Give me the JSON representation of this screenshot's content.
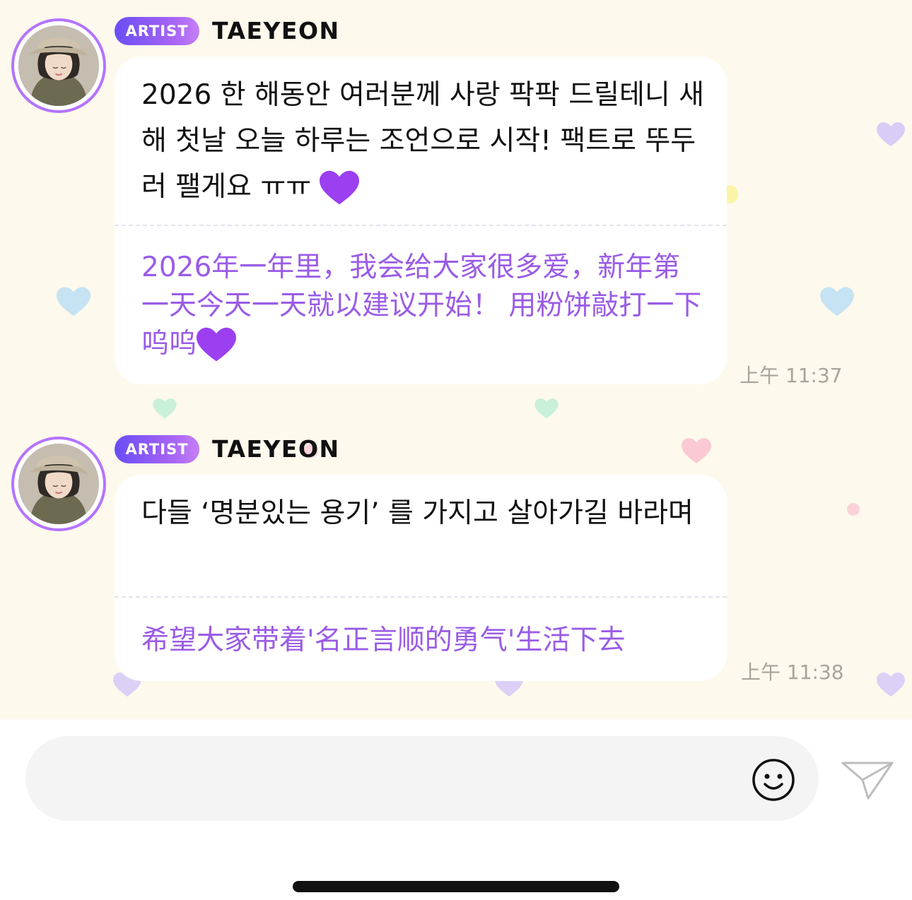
{
  "messages": [
    {
      "badge": "ARTIST",
      "sender": "TAEYEON",
      "text_ko": "2026 한 해동안 여러분께 사랑 팍팍 드릴테니 새해 첫날 오늘 하루는 조언으로 시작! 팩트로 뚜두러 팰게요 ㅠㅠ",
      "text_zh": "2026年一年里，我会给大家很多爱，新年第一天今天一天就以建议开始！ 用粉饼敲打一下 呜呜",
      "time": "上午 11:37"
    },
    {
      "badge": "ARTIST",
      "sender": "TAEYEON",
      "text_ko": "다들 ‘명분있는 용기’ 를 가지고 살아가길 바라며",
      "text_zh": "希望大家带着'名正言顺的勇气'生活下去",
      "time": "上午 11:38"
    }
  ],
  "composer": {
    "placeholder": "",
    "emoji_icon": "smiley-icon",
    "send_icon": "paper-plane-icon"
  },
  "colors": {
    "background": "#fdf9ec",
    "accent_purple": "#9a5ce6",
    "badge_gradient_start": "#6a4df5",
    "badge_gradient_end": "#c57ff5"
  }
}
